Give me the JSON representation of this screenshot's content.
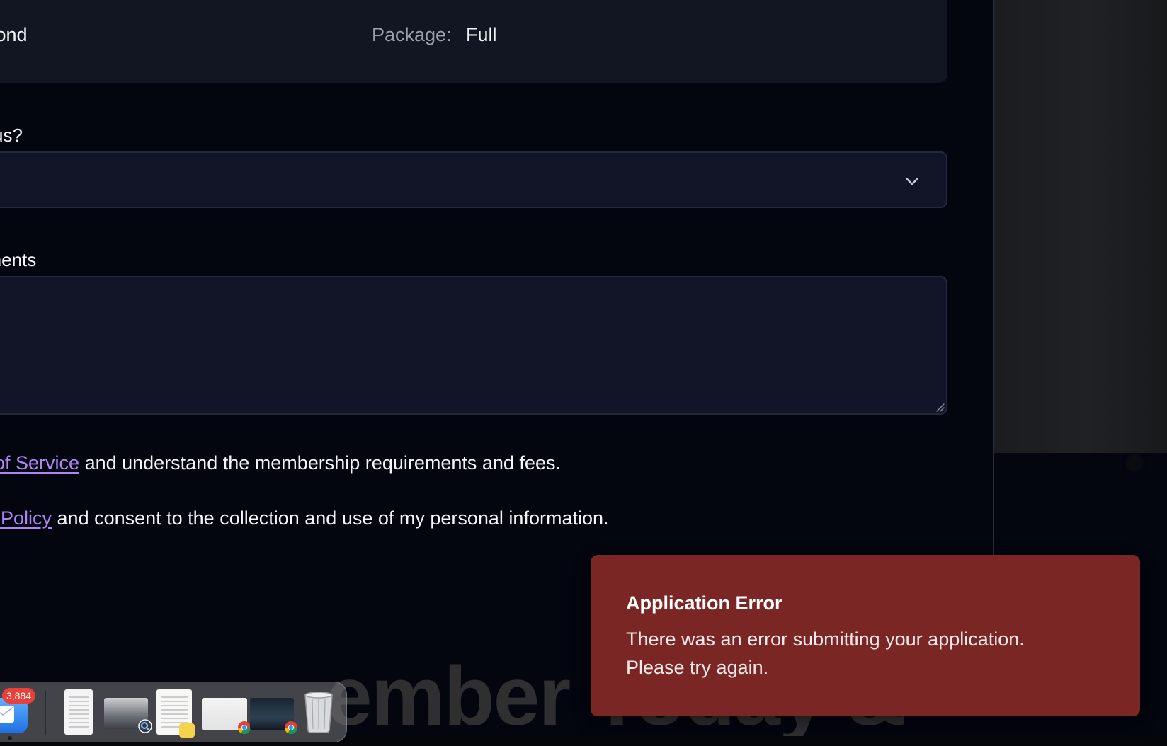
{
  "summary": {
    "left_value": "amond",
    "package_label": "Package:",
    "package_value": "Full"
  },
  "form": {
    "source_label": "us?",
    "select_value": "",
    "comments_label": "nments",
    "comments_value": ""
  },
  "consent": {
    "terms_link": "of Service",
    "terms_text": " and understand the membership requirements and fees.",
    "privacy_link": "y Policy",
    "privacy_text": " and consent to the collection and use of my personal information."
  },
  "background": {
    "hero_text": "ember Today &"
  },
  "toast": {
    "title": "Application Error",
    "message": "There was an error submitting your application. Please try again.",
    "color": "#7a2624"
  },
  "dock": {
    "mail_badge": "3,884",
    "items": [
      {
        "name": "mail-app",
        "icon": "envelope-icon"
      },
      {
        "name": "document-app",
        "icon": "document-icon"
      },
      {
        "name": "preview-window",
        "icon": "preview-icon"
      },
      {
        "name": "notes-app",
        "icon": "notes-icon"
      },
      {
        "name": "chrome-window-1",
        "icon": "chrome-icon"
      },
      {
        "name": "chrome-window-2",
        "icon": "chrome-icon"
      },
      {
        "name": "trash",
        "icon": "trash-icon"
      }
    ]
  },
  "colors": {
    "background": "#03050f",
    "card": "#111622",
    "input": "#121527",
    "link": "#b084f5",
    "error": "#7a2624"
  }
}
